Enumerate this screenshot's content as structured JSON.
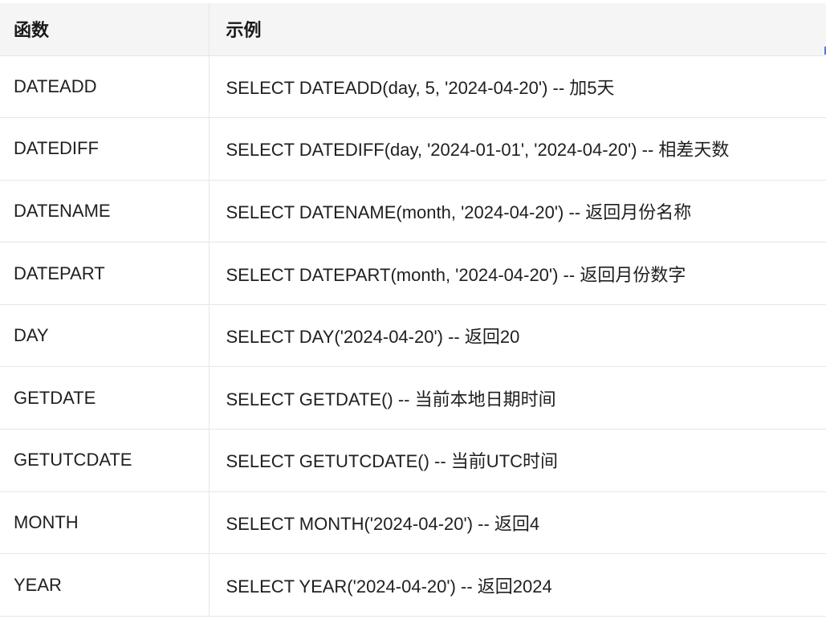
{
  "table": {
    "headers": [
      "函数",
      "示例"
    ],
    "rows": [
      {
        "func": "DATEADD",
        "example": "SELECT DATEADD(day, 5, '2024-04-20') -- 加5天"
      },
      {
        "func": "DATEDIFF",
        "example": "SELECT DATEDIFF(day, '2024-01-01', '2024-04-20') -- 相差天数"
      },
      {
        "func": "DATENAME",
        "example": "SELECT DATENAME(month, '2024-04-20') -- 返回月份名称"
      },
      {
        "func": "DATEPART",
        "example": "SELECT DATEPART(month, '2024-04-20') -- 返回月份数字"
      },
      {
        "func": "DAY",
        "example": "SELECT DAY('2024-04-20') -- 返回20"
      },
      {
        "func": "GETDATE",
        "example": "SELECT GETDATE() -- 当前本地日期时间"
      },
      {
        "func": "GETUTCDATE",
        "example": "SELECT GETUTCDATE() -- 当前UTC时间"
      },
      {
        "func": "MONTH",
        "example": "SELECT MONTH('2024-04-20') -- 返回4"
      },
      {
        "func": "YEAR",
        "example": "SELECT YEAR('2024-04-20') -- 返回2024"
      }
    ]
  },
  "colors": {
    "header_bg": "#f5f5f5",
    "border": "#e6e6e6",
    "text": "#1f1f1f"
  }
}
